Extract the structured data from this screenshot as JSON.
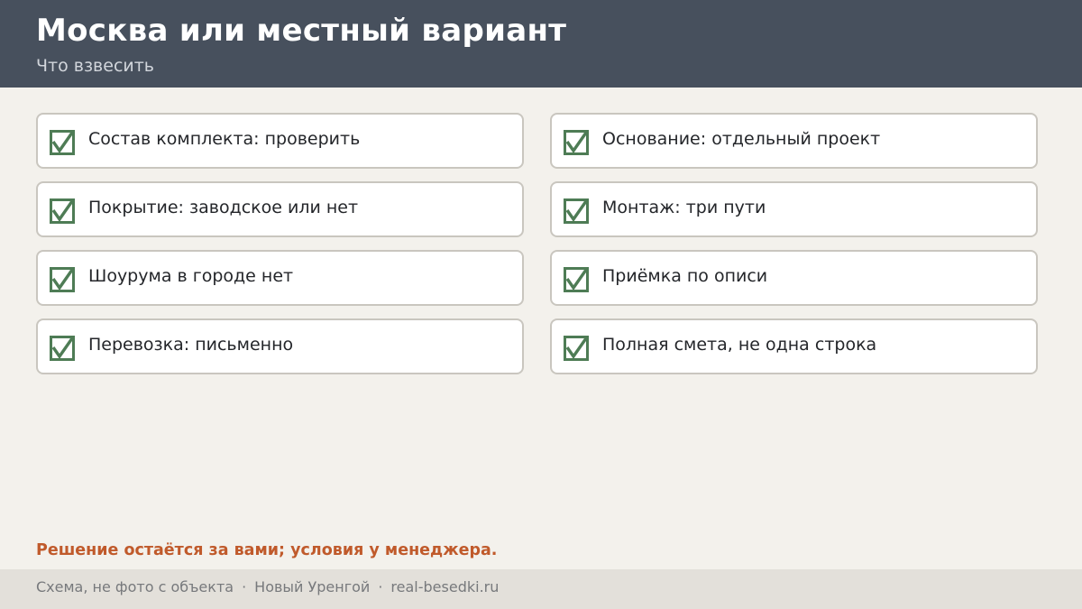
{
  "header": {
    "title": "Москва или местный вариант",
    "subtitle": "Что взвесить"
  },
  "checklist": {
    "left": [
      "Состав комплекта: проверить",
      "Покрытие: заводское или нет",
      "Шоурума в городе нет",
      "Перевозка: письменно"
    ],
    "right": [
      "Основание: отдельный проект",
      "Монтаж: три пути",
      "Приёмка по описи",
      "Полная смета, не одна строка"
    ],
    "checkbox_icon": "checkbox-checked-icon",
    "check_color": "#4e7c55"
  },
  "decision_note": "Решение остаётся за вами; условия у менеджера.",
  "footer": {
    "note": "Схема, не фото с объекта",
    "city": "Новый Уренгой",
    "site": "real-besedki.ru",
    "separator": "·"
  },
  "colors": {
    "header_bg": "#47505d",
    "page_bg": "#f3f1ec",
    "accent": "#c05a2b",
    "footer_bg": "#e3e0da"
  }
}
